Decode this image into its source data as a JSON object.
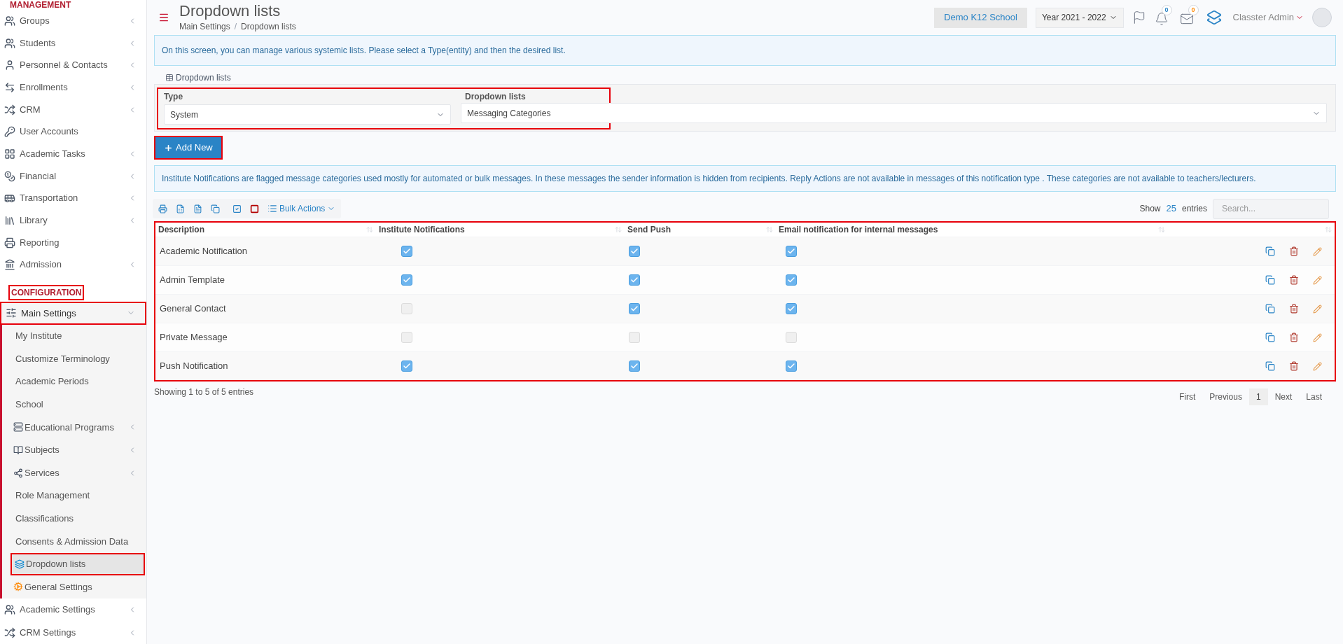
{
  "sidebar": {
    "section_top": "MANAGEMENT",
    "items": [
      {
        "label": "Groups",
        "submenu": true
      },
      {
        "label": "Students",
        "submenu": true
      },
      {
        "label": "Personnel & Contacts",
        "submenu": true
      },
      {
        "label": "Enrollments",
        "submenu": true
      },
      {
        "label": "CRM",
        "submenu": true
      },
      {
        "label": "User Accounts",
        "submenu": false
      },
      {
        "label": "Academic Tasks",
        "submenu": true
      },
      {
        "label": "Financial",
        "submenu": true
      },
      {
        "label": "Transportation",
        "submenu": true
      },
      {
        "label": "Library",
        "submenu": true
      },
      {
        "label": "Reporting",
        "submenu": false
      },
      {
        "label": "Admission",
        "submenu": true
      }
    ],
    "section_config": "CONFIGURATION",
    "config_items": [
      {
        "label": "Main Settings",
        "submenu": true,
        "expanded": true,
        "children": [
          {
            "label": "My Institute",
            "submenu": false,
            "selected": false
          },
          {
            "label": "Customize Terminology",
            "submenu": false,
            "selected": false
          },
          {
            "label": "Academic Periods",
            "submenu": false,
            "selected": false
          },
          {
            "label": "School",
            "submenu": false,
            "selected": false
          },
          {
            "label": "Educational Programs",
            "submenu": true,
            "selected": false
          },
          {
            "label": "Subjects",
            "submenu": true,
            "selected": false
          },
          {
            "label": "Services",
            "submenu": true,
            "selected": false
          },
          {
            "label": "Role Management",
            "submenu": false,
            "selected": false
          },
          {
            "label": "Classifications",
            "submenu": false,
            "selected": false
          },
          {
            "label": "Consents & Admission Data",
            "submenu": false,
            "selected": false
          },
          {
            "label": "Dropdown lists",
            "submenu": false,
            "selected": true
          },
          {
            "label": "General Settings",
            "submenu": false,
            "selected": false
          }
        ]
      },
      {
        "label": "Academic Settings",
        "submenu": true,
        "expanded": false
      },
      {
        "label": "CRM Settings",
        "submenu": true,
        "expanded": false
      }
    ]
  },
  "header": {
    "title": "Dropdown lists",
    "breadcrumb": [
      "Main Settings",
      "Dropdown lists"
    ],
    "separator": "/",
    "school": "Demo K12 School",
    "year": "Year 2021 - 2022",
    "notifications": "0",
    "messages": "0",
    "user": "Classter Admin"
  },
  "intro": "On this screen, you can manage various systemic lists. Please select a Type(entity) and then the desired list.",
  "filter": {
    "legend": "Dropdown lists",
    "type_label": "Type",
    "type_value": "System",
    "list_label": "Dropdown lists",
    "list_value": "Messaging Categories"
  },
  "add_button": "Add New",
  "note": "Institute Notifications are flagged message categories used mostly for automated or bulk messages. In these messages the sender information is hidden from recipients. Reply Actions are not available in messages of this notification type . These categories are not available to teachers/lecturers.",
  "toolbar": {
    "bulk": "Bulk Actions",
    "show": "Show",
    "page_size": "25",
    "entries": "entries",
    "search_placeholder": "Search..."
  },
  "table": {
    "columns": [
      "Description",
      "Institute Notifications",
      "Send Push",
      "Email notification for internal messages"
    ],
    "rows": [
      {
        "description": "Academic Notification",
        "institute": true,
        "push": true,
        "email": true
      },
      {
        "description": "Admin Template",
        "institute": true,
        "push": true,
        "email": true
      },
      {
        "description": "General Contact",
        "institute": false,
        "push": true,
        "email": true
      },
      {
        "description": "Private Message",
        "institute": false,
        "push": false,
        "email": false
      },
      {
        "description": "Push Notification",
        "institute": true,
        "push": true,
        "email": true
      }
    ]
  },
  "footer": {
    "summary": "Showing 1 to 5 of 5 entries",
    "pages": [
      {
        "label": "First",
        "selected": false
      },
      {
        "label": "Previous",
        "selected": false
      },
      {
        "label": "1",
        "selected": true
      },
      {
        "label": "Next",
        "selected": false
      },
      {
        "label": "Last",
        "selected": false
      }
    ]
  }
}
